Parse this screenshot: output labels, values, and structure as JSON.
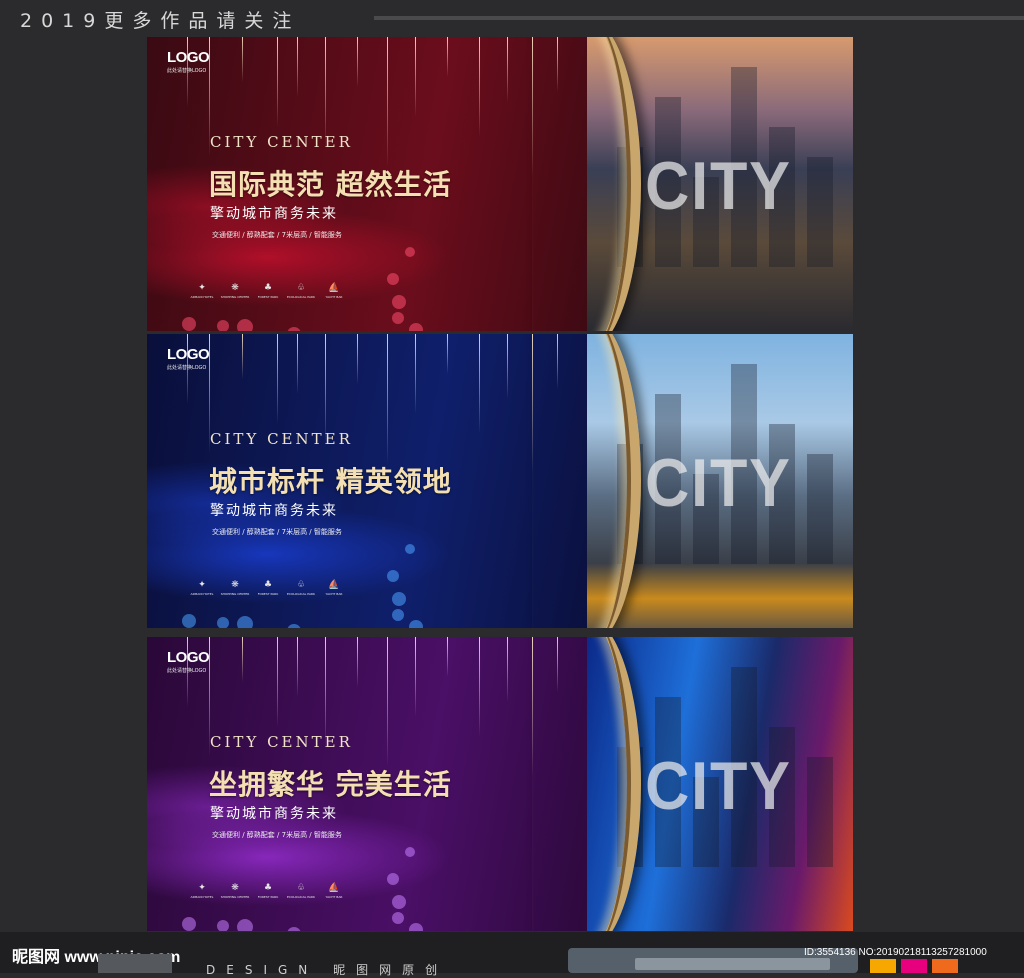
{
  "header": {
    "title": "2019更多作品请关注"
  },
  "banners": [
    {
      "theme": "red",
      "colors": {
        "bg_dark": "#3a0a12",
        "bg_mid": "#6b0d1c",
        "swirl": "#c8102e",
        "dot": "#ff4d6d"
      },
      "logo": "LOGO",
      "logo_sub": "此处请替换LOGO",
      "city_center": "CITY CENTER",
      "headline": "国际典范 超然生活",
      "subhead": "擎动城市商务未来",
      "features": "交通便利 / 醇熟配套 / 7米层高 / 智能服务",
      "photo_word": "CITY",
      "photo_icon": "city-skyline-photo"
    },
    {
      "theme": "blue",
      "colors": {
        "bg_dark": "#0a0f3a",
        "bg_mid": "#0f1f6b",
        "swirl": "#1a3fd6",
        "dot": "#4da3ff"
      },
      "logo": "LOGO",
      "logo_sub": "此处请替换LOGO",
      "city_center": "CITY CENTER",
      "headline": "城市标杆 精英领地",
      "subhead": "擎动城市商务未来",
      "features": "交通便利 / 醇熟配套 / 7米层高 / 智能服务",
      "photo_word": "CITY",
      "photo_icon": "times-square-photo"
    },
    {
      "theme": "purple",
      "colors": {
        "bg_dark": "#2a0838",
        "bg_mid": "#4a0f66",
        "swirl": "#9a2ed6",
        "dot": "#c77dff"
      },
      "logo": "LOGO",
      "logo_sub": "此处请替换LOGO",
      "city_center": "CITY CENTER",
      "headline": "坐拥繁华 完美生活",
      "subhead": "擎动城市商务未来",
      "features": "交通便利 / 醇熟配套 / 7米层高 / 智能服务",
      "photo_word": "CITY",
      "photo_icon": "neon-street-photo"
    }
  ],
  "amenities": [
    {
      "icon": "hotel-icon",
      "glyph": "✦",
      "label": "ARMANI HOTEL"
    },
    {
      "icon": "shopping-icon",
      "glyph": "❋",
      "label": "SHOPPING CENTER"
    },
    {
      "icon": "forest-icon",
      "glyph": "♣",
      "label": "FOREST PARK"
    },
    {
      "icon": "ecology-icon",
      "glyph": "♧",
      "label": "ECOLOGICAL PARK"
    },
    {
      "icon": "yacht-icon",
      "glyph": "⛵",
      "label": "YACHT BAR"
    }
  ],
  "watermark": {
    "site": "昵图网 www.nipic.com",
    "design": "DESIGN 昵图网原创",
    "id": "ID:3554136 NO:20190218113257281000",
    "swatches": [
      "#f7a800",
      "#e6007e",
      "#f06a1d"
    ]
  }
}
